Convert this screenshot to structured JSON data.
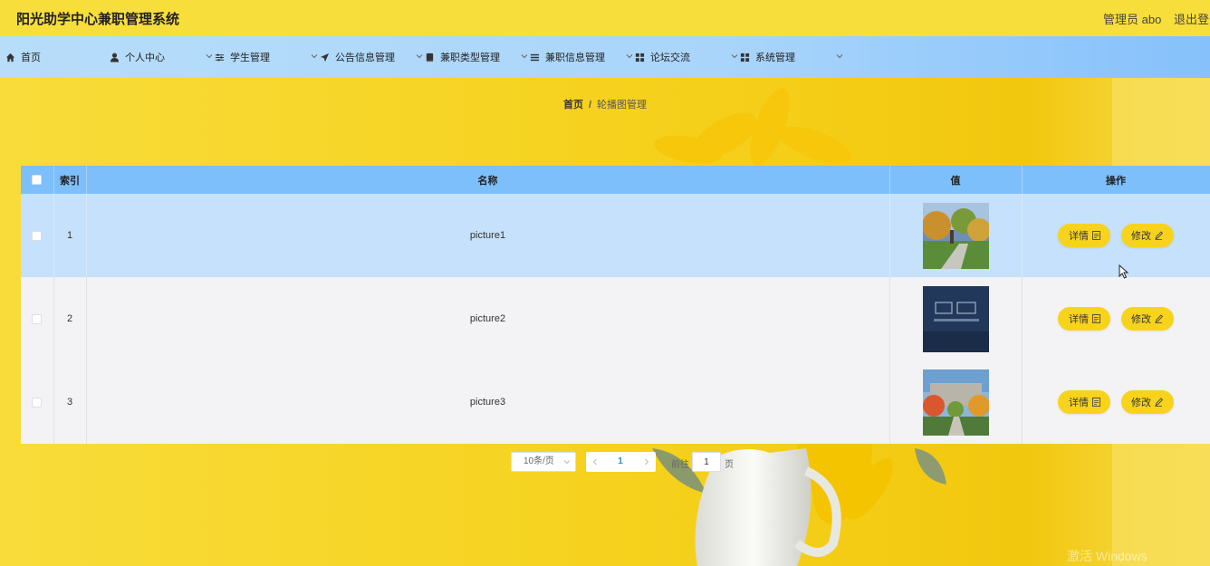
{
  "header": {
    "title": "阳光助学中心兼职管理系统",
    "admin": "管理员 abo",
    "logout": "退出登录"
  },
  "nav": {
    "items": [
      {
        "label": "首页",
        "icon": "home-icon"
      },
      {
        "label": "个人中心",
        "icon": "user-icon"
      },
      {
        "label": "学生管理",
        "icon": "sliders-icon"
      },
      {
        "label": "公告信息管理",
        "icon": "paper-plane-icon"
      },
      {
        "label": "兼职类型管理",
        "icon": "book-icon"
      },
      {
        "label": "兼职信息管理",
        "icon": "list-icon"
      },
      {
        "label": "论坛交流",
        "icon": "grid-icon"
      },
      {
        "label": "系统管理",
        "icon": "grid-icon"
      }
    ]
  },
  "breadcrumb": {
    "home": "首页",
    "separator": "/",
    "current": "轮播图管理"
  },
  "table": {
    "columns": [
      "索引",
      "名称",
      "值",
      "操作"
    ],
    "rows": [
      {
        "index": "1",
        "name": "picture1",
        "image": "campus-trees-photo"
      },
      {
        "index": "2",
        "name": "picture2",
        "image": "dark-building-sign-photo"
      },
      {
        "index": "3",
        "name": "picture3",
        "image": "campus-garden-photo"
      }
    ],
    "detail_label": "详情",
    "edit_label": "修改"
  },
  "pagination": {
    "page_size": "10条/页",
    "current_page": "1",
    "goto_label": "前往",
    "goto_value": "1",
    "page_label": "页"
  },
  "watermark": "激活 Windows",
  "colors": {
    "header_bg": "#f8de3a",
    "nav_bg": "#a9d5fb",
    "table_header": "#7cbffb",
    "selected_row": "#c6e1fb",
    "button": "#f8d31c"
  }
}
